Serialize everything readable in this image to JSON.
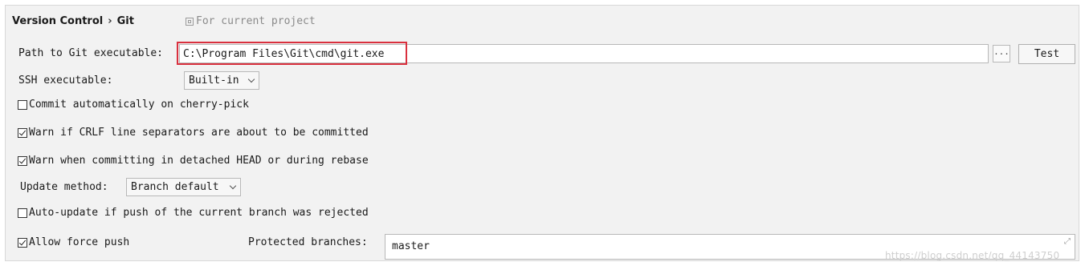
{
  "breadcrumb": {
    "parent": "Version Control",
    "separator": "›",
    "current": "Git"
  },
  "project_hint": {
    "icon": "copy-icon",
    "text": "For current project"
  },
  "git_path": {
    "label": "Path to Git executable:",
    "value": "C:\\Program Files\\Git\\cmd\\git.exe",
    "browse_label": "...",
    "test_label": "Test"
  },
  "ssh": {
    "label": "SSH executable:",
    "selected": "Built-in"
  },
  "options": {
    "commit_cherry_pick": {
      "label": "Commit automatically on cherry-pick",
      "checked": false
    },
    "warn_crlf": {
      "label": "Warn if CRLF line separators are about to be committed",
      "checked": true
    },
    "warn_detached": {
      "label": "Warn when committing in detached HEAD or during rebase",
      "checked": true
    },
    "auto_update": {
      "label": "Auto-update if push of the current branch was rejected",
      "checked": false
    },
    "allow_force_push": {
      "label": "Allow force push",
      "checked": true
    }
  },
  "update_method": {
    "label": "Update method:",
    "selected": "Branch default"
  },
  "protected_branches": {
    "label": "Protected branches:",
    "value": "master"
  },
  "watermark": "https://blog.csdn.net/qq_44143750",
  "colors": {
    "highlight": "#d9303e",
    "panel_background": "#f2f2f2"
  }
}
